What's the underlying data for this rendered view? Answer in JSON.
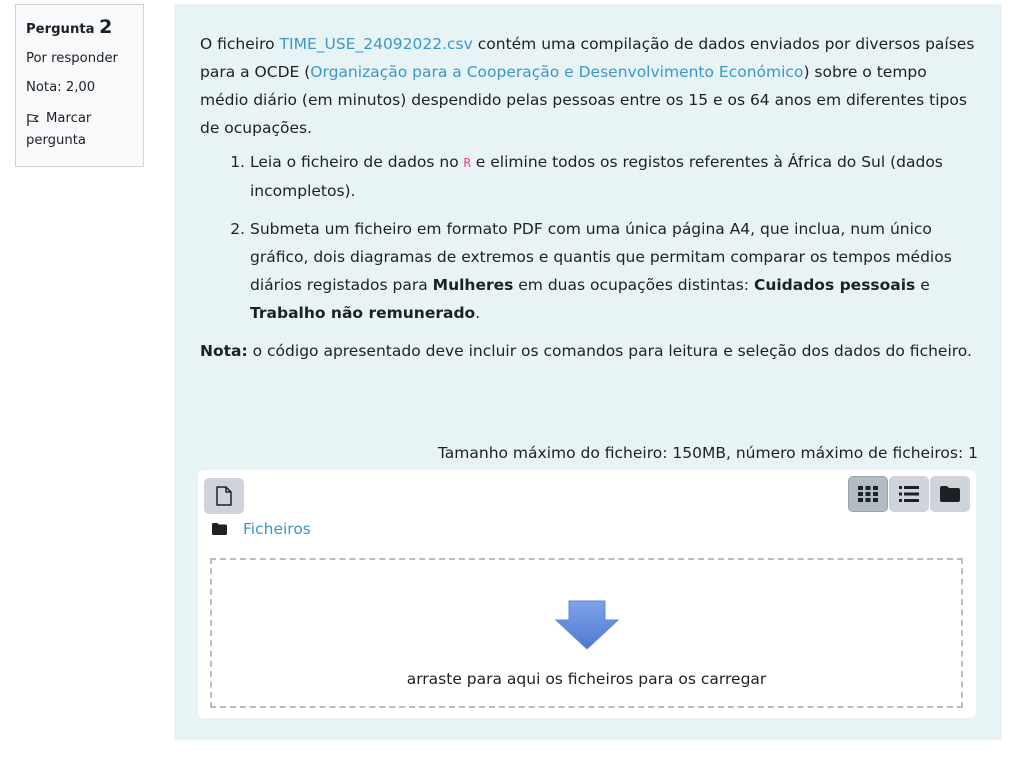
{
  "question_info": {
    "label": "Pergunta",
    "number": "2",
    "status": "Por responder",
    "grade": "Nota: 2,00",
    "flag_label": "Marcar",
    "flag_label_line2": "pergunta"
  },
  "question": {
    "intro_1": "O ficheiro ",
    "file_link": "TIME_USE_24092022.csv",
    "intro_2": " contém uma compilação de dados enviados por diversos países para a OCDE (",
    "org_link": "Organização para a Cooperação e Desenvolvimento Económico",
    "intro_3": ") sobre o tempo médio diário (em minutos) despendido pelas pessoas entre os 15 e os 64 anos em diferentes tipos de ocupações.",
    "step1_a": "Leia o ficheiro de dados no ",
    "step1_code": "R",
    "step1_b": " e elimine todos os registos referentes à África do Sul (dados incompletos).",
    "step2_a": "Submeta um ficheiro em formato PDF com uma única página A4, que inclua, num único gráfico, dois diagramas de extremos e quantis que permitam comparar os tempos médios diários registados para ",
    "step2_b1": "Mulheres",
    "step2_c": " em duas ocupações distintas: ",
    "step2_b2": "Cuidados pessoais",
    "step2_d": " e ",
    "step2_b3": "Trabalho não remunerado",
    "step2_e": ".",
    "note_label": "Nota:",
    "note_text": " o código apresentado deve incluir os comandos para leitura e seleção dos dados do ficheiro."
  },
  "filepicker": {
    "max_size": "Tamanho máximo do ficheiro: 150MB, número máximo de ficheiros: 1",
    "path_label": "Ficheiros",
    "drop_message": "arraste para aqui os ficheiros para os carregar",
    "view_modes": [
      "icons",
      "details",
      "tree"
    ],
    "active_view": "icons",
    "accent_color": "#3a98c9",
    "panel_color": "#e7f3f5"
  }
}
